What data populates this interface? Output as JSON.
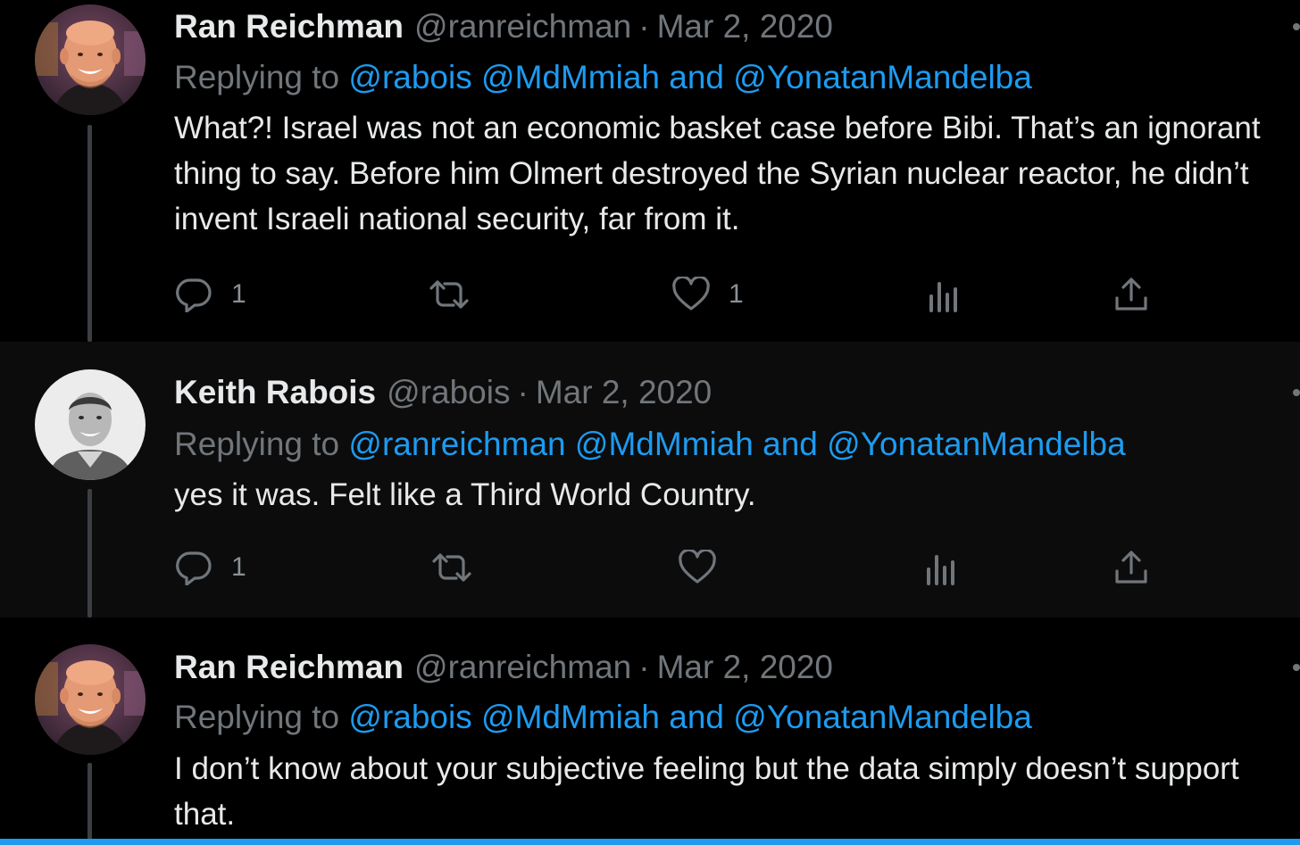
{
  "colors": {
    "background": "#000000",
    "background_alt": "#0c0c0c",
    "text_primary": "#e7e9ea",
    "text_secondary": "#71767b",
    "accent": "#1d9bf0"
  },
  "tweets": [
    {
      "author": "Ran Reichman",
      "handle": "@ranreichman",
      "separator": "·",
      "date": "Mar 2, 2020",
      "replying_prefix": "Replying to",
      "mention_1": "@rabois",
      "mention_2": "@MdMmiah",
      "and_word": "and",
      "mention_3": "@YonatanMandelba",
      "text": "What?! Israel was not an economic basket case before Bibi. That’s an ignorant thing to say. Before him Olmert destroyed the Syrian nuclear reactor, he didn’t invent Israeli national security, far from it.",
      "reply_count": "1",
      "retweet_count": "",
      "like_count": "1",
      "avatar_icon": "avatar-bald-smiling-man"
    },
    {
      "author": "Keith Rabois",
      "handle": "@rabois",
      "separator": "·",
      "date": "Mar 2, 2020",
      "replying_prefix": "Replying to",
      "mention_1": "@ranreichman",
      "mention_2": "@MdMmiah",
      "and_word": "and",
      "mention_3": "@YonatanMandelba",
      "text": "yes it was.  Felt like a Third World Country.",
      "reply_count": "1",
      "retweet_count": "",
      "like_count": "",
      "avatar_icon": "avatar-grayscale-man"
    },
    {
      "author": "Ran Reichman",
      "handle": "@ranreichman",
      "separator": "·",
      "date": "Mar 2, 2020",
      "replying_prefix": "Replying to",
      "mention_1": "@rabois",
      "mention_2": "@MdMmiah",
      "and_word": "and",
      "mention_3": "@YonatanMandelba",
      "text": "I don’t know about your subjective feeling but the data simply doesn’t support that.",
      "avatar_icon": "avatar-bald-smiling-man"
    }
  ],
  "icons": {
    "reply": "reply-bubble-icon",
    "retweet": "retweet-arrows-icon",
    "like": "heart-icon",
    "views": "bar-chart-icon",
    "share": "share-upload-icon",
    "more": "more-dot-icon"
  }
}
